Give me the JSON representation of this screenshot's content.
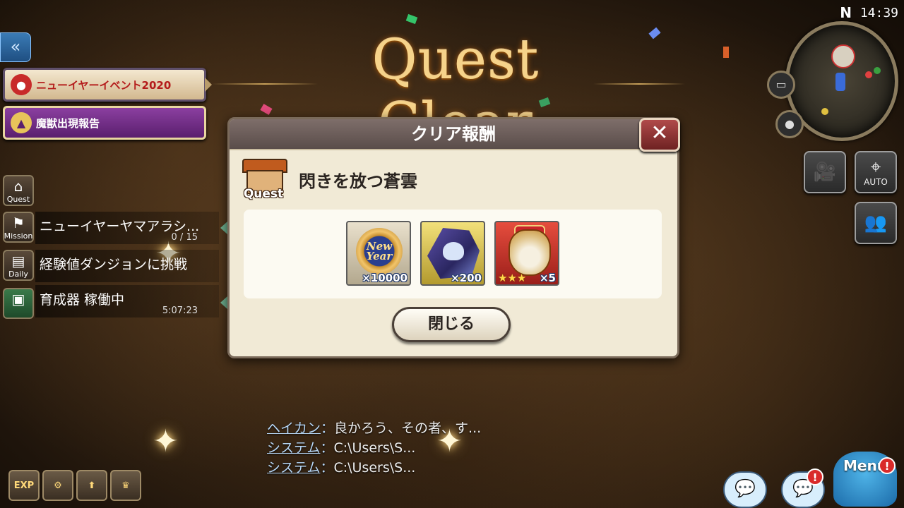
{
  "title": "Quest Clear",
  "clock": "14:39",
  "compass": "N",
  "left_panel": {
    "collapse_glyph": "«",
    "event_banner_1": "ニューイヤーイベント2020",
    "event_banner_2": "魔獣出現報告",
    "tabs": [
      {
        "label": "Quest"
      },
      {
        "label": "Mission"
      },
      {
        "label": "Daily"
      },
      {
        "label": ""
      }
    ],
    "rows": [
      {
        "text": "ニューイヤーヤマアラシ...",
        "sub": "0 / 15"
      },
      {
        "text": "経験値ダンジョンに挑戦",
        "sub": ""
      },
      {
        "text": "育成器 稼働中",
        "sub": "5:07:23"
      }
    ]
  },
  "dialog": {
    "header": "クリア報酬",
    "close_glyph": "✕",
    "quest_badge_label": "Quest",
    "quest_name": "閃きを放つ蒼雲",
    "rewards": [
      {
        "icon": "new-year-coin",
        "coin_text": "New Year",
        "quantity": "×10000"
      },
      {
        "icon": "blue-dragon-gem",
        "quantity": "×200"
      },
      {
        "icon": "lucky-bag",
        "stars": "★★★",
        "quantity": "×5"
      }
    ],
    "close_button": "閉じる"
  },
  "chat": [
    {
      "name": "ヘイカン",
      "sep": "：",
      "message": "良かろう、その者、す..."
    },
    {
      "name": "システム",
      "sep": "：",
      "message": "C:\\Users\\S..."
    },
    {
      "name": "システム",
      "sep": "：",
      "message": "C:\\Users\\S..."
    }
  ],
  "right_buttons": {
    "camera": "🎥",
    "auto_label": "AUTO",
    "party": "👥"
  },
  "bottom_buttons": [
    "EXP",
    "⚙",
    "⬆",
    "♛"
  ],
  "chat_button_glyph": "💬",
  "notif_glyph": "!",
  "menu_label": "Menu",
  "colors": {
    "title_gold": "#f6d38a",
    "dialog_bg": "#f1ead6",
    "header_bg": "#5a4d4a",
    "close_red": "#b04a4a",
    "chat_name": "#b7d7f7"
  }
}
